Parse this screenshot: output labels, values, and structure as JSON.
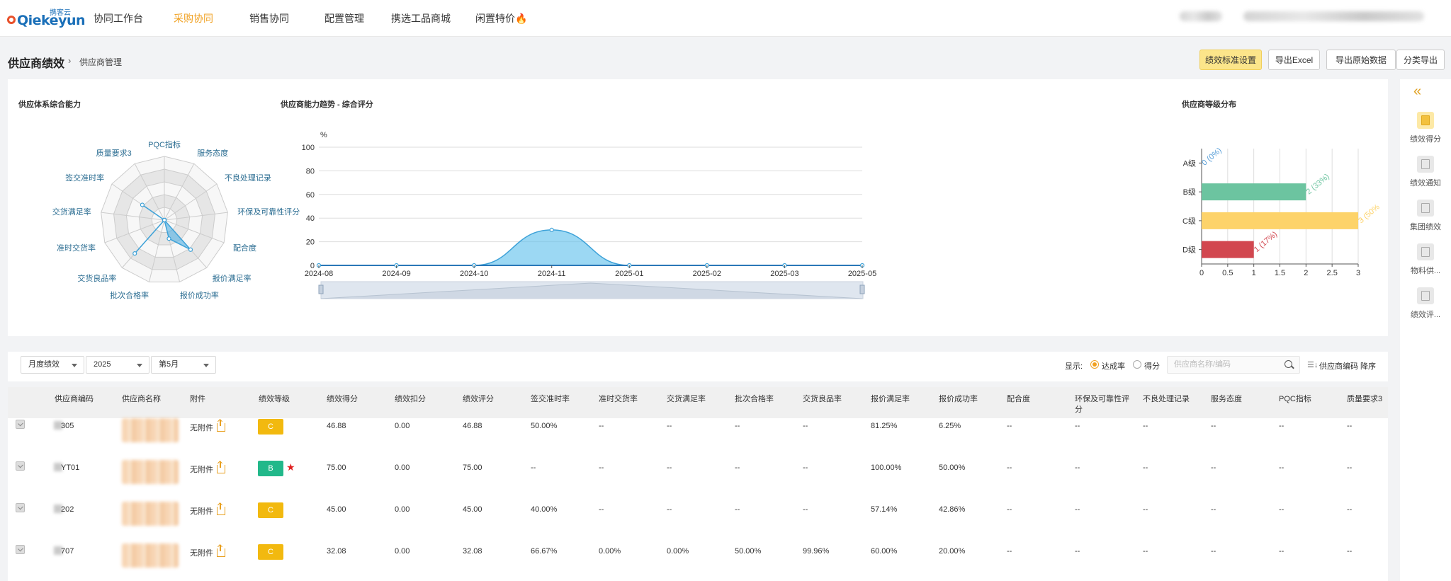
{
  "app": {
    "logo_text": "Qiekeyun",
    "logo_sub": "携客云"
  },
  "nav": {
    "items": [
      {
        "label": "协同工作台",
        "active": false
      },
      {
        "label": "采购协同",
        "active": true
      },
      {
        "label": "销售协同",
        "active": false
      },
      {
        "label": "配置管理",
        "active": false
      },
      {
        "label": "携选工品商城",
        "active": false
      },
      {
        "label": "闲置特价🔥",
        "active": false
      }
    ]
  },
  "breadcrumb": {
    "title": "供应商绩效",
    "sub": "供应商管理"
  },
  "toolbar": {
    "standard_btn": "绩效标准设置",
    "export_excel_btn": "导出Excel",
    "export_raw_btn": "导出原始数据",
    "export_cat_btn": "分类导出"
  },
  "charts": {
    "radar_title": "供应体系综合能力",
    "trend_title": "供应商能力趋势 - 综合评分",
    "grade_title": "供应商等级分布"
  },
  "chart_data": [
    {
      "type": "radar",
      "title": "供应体系综合能力",
      "indicators": [
        "PQC指标",
        "服务态度",
        "不良处理记录",
        "环保及可靠性评分",
        "配合度",
        "报价满足率",
        "报价成功率",
        "批次合格率",
        "交货良品率",
        "准时交货率",
        "交货满足率",
        "签交准时率",
        "质量要求3"
      ],
      "values": [
        0,
        0,
        0,
        0,
        0,
        62,
        30,
        0,
        70,
        0,
        0,
        42,
        0
      ],
      "max": 100
    },
    {
      "type": "area",
      "title": "供应商能力趋势 - 综合评分",
      "ylabel": "%",
      "ylim": [
        0,
        100
      ],
      "yticks": [
        0,
        20,
        40,
        60,
        80,
        100
      ],
      "x": [
        "2024-08",
        "2024-09",
        "2024-10",
        "2024-11",
        "2025-01",
        "2025-02",
        "2025-03",
        "2025-05"
      ],
      "values": [
        0,
        0,
        0,
        30,
        0,
        0,
        0,
        0
      ]
    },
    {
      "type": "bar",
      "orientation": "horizontal",
      "title": "供应商等级分布",
      "categories": [
        "A级",
        "B级",
        "C级",
        "D级"
      ],
      "values": [
        0,
        2,
        3,
        1
      ],
      "labels": [
        "0 (0%)",
        "2 (33%)",
        "3 (50%",
        "1 (17%)"
      ],
      "colors": [
        "#5aa0d8",
        "#6cc4a0",
        "#fdd36a",
        "#d2474f"
      ],
      "xlim": [
        0,
        3
      ],
      "xticks": [
        "0",
        "0.5",
        "1",
        "1.5",
        "2",
        "2.5",
        "3"
      ]
    }
  ],
  "sidebar": {
    "collapse_icon": "«",
    "items": [
      {
        "label": "绩效得分",
        "active": true
      },
      {
        "label": "绩效通知",
        "active": false
      },
      {
        "label": "集团绩效",
        "active": false
      },
      {
        "label": "物料供...",
        "active": false
      },
      {
        "label": "绩效评...",
        "active": false
      }
    ]
  },
  "filters": {
    "period": "月度绩效",
    "year": "2025",
    "month": "第5月",
    "show_label": "显示:",
    "opt1": "达成率",
    "opt2": "得分",
    "search_placeholder": "供应商名称/编码",
    "sort_icon": "☰↓",
    "sort_label": "供应商编码 降序"
  },
  "table": {
    "headers": [
      "供应商编码",
      "供应商名称",
      "附件",
      "绩效等级",
      "绩效得分",
      "绩效扣分",
      "绩效评分",
      "签交准时率",
      "准时交货率",
      "交货满足率",
      "批次合格率",
      "交货良品率",
      "报价满足率",
      "报价成功率",
      "配合度",
      "环保及可靠性评\n分",
      "不良处理记录",
      "服务态度",
      "PQC指标",
      "质量要求3"
    ],
    "rows": [
      {
        "code": "305",
        "attach": "无附件",
        "grade": "C",
        "grade_color": "#f2b90f",
        "star": false,
        "score": "46.88",
        "deduct": "0.00",
        "rating": "46.88",
        "c1": "50.00%",
        "c2": "--",
        "c3": "--",
        "c4": "--",
        "c5": "--",
        "c6": "81.25%",
        "c7": "6.25%",
        "c8": "--",
        "c9": "--",
        "c10": "--",
        "c11": "--",
        "c12": "--",
        "c13": "--"
      },
      {
        "code": "YT01",
        "attach": "无附件",
        "grade": "B",
        "grade_color": "#22b88a",
        "star": true,
        "score": "75.00",
        "deduct": "0.00",
        "rating": "75.00",
        "c1": "--",
        "c2": "--",
        "c3": "--",
        "c4": "--",
        "c5": "--",
        "c6": "100.00%",
        "c7": "50.00%",
        "c8": "--",
        "c9": "--",
        "c10": "--",
        "c11": "--",
        "c12": "--",
        "c13": "--"
      },
      {
        "code": "202",
        "attach": "无附件",
        "grade": "C",
        "grade_color": "#f2b90f",
        "star": false,
        "score": "45.00",
        "deduct": "0.00",
        "rating": "45.00",
        "c1": "40.00%",
        "c2": "--",
        "c3": "--",
        "c4": "--",
        "c5": "--",
        "c6": "57.14%",
        "c7": "42.86%",
        "c8": "--",
        "c9": "--",
        "c10": "--",
        "c11": "--",
        "c12": "--",
        "c13": "--"
      },
      {
        "code": "707",
        "attach": "无附件",
        "grade": "C",
        "grade_color": "#f2b90f",
        "star": false,
        "score": "32.08",
        "deduct": "0.00",
        "rating": "32.08",
        "c1": "66.67%",
        "c2": "0.00%",
        "c3": "0.00%",
        "c4": "50.00%",
        "c5": "99.96%",
        "c6": "60.00%",
        "c7": "20.00%",
        "c8": "--",
        "c9": "--",
        "c10": "--",
        "c11": "--",
        "c12": "--",
        "c13": "--"
      }
    ]
  }
}
